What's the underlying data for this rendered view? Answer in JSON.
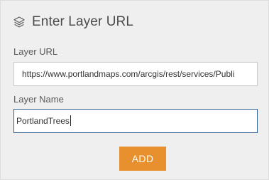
{
  "panel": {
    "title": "Enter Layer URL",
    "title_icon": "layers-icon"
  },
  "form": {
    "url_label": "Layer URL",
    "url_value": "https://www.portlandmaps.com/arcgis/rest/services/Public/",
    "url_visible_value": "https://www.portlandmaps.com/arcgis/rest/services/Publi",
    "name_label": "Layer Name",
    "name_value": "PortlandTrees",
    "name_focused": true
  },
  "actions": {
    "add_label": "ADD"
  },
  "colors": {
    "accent": "#e9902e",
    "focus_border": "#2f5f91",
    "panel_bg": "#efefef"
  }
}
